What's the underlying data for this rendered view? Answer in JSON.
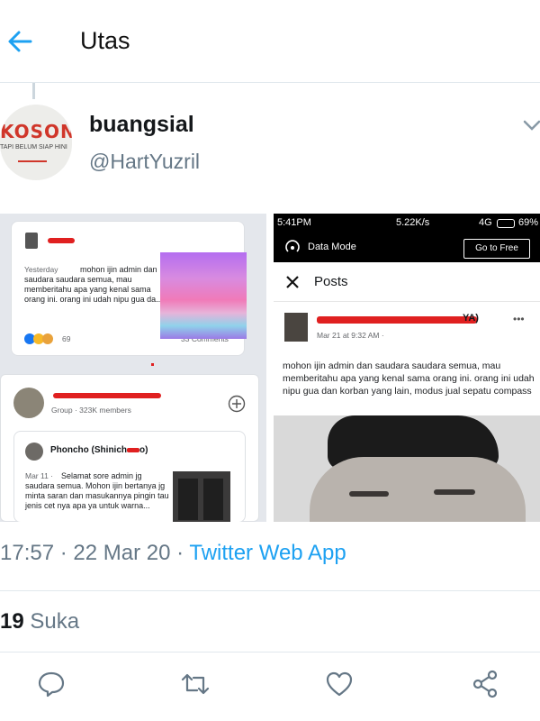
{
  "header": {
    "title": "Utas",
    "back_icon": "arrow-left-icon"
  },
  "tweet": {
    "avatar": {
      "title": "KOSONG",
      "subtitle": "TAPI BELUM SIAP HINI"
    },
    "name": "buangsial",
    "handle": "@HartYuzril",
    "time": "17:57",
    "date": "22 Mar 20",
    "separator": "·",
    "source": "Twitter Web App",
    "likes_count": "19",
    "likes_label": "Suka"
  },
  "screenshot_left": {
    "post1": {
      "time": "Yesterday",
      "text": "mohon ijin admin dan saudara saudara semua, mau memberitahu apa yang kenal sama orang ini. orang ini udah nipu gua da...",
      "reactions": "69",
      "comments": "33 Comments"
    },
    "group": {
      "members": "Group · 323K members"
    },
    "post2": {
      "author": "Phoncho (Shinich",
      "author_end": "o)",
      "time": "Mar 11 ·",
      "text": "Selamat sore admin jg saudara semua. Mohon ijin bertanya jg minta saran dan masukannya pingin tau jenis cet nya apa ya untuk warna..."
    }
  },
  "screenshot_right": {
    "status_time": "5:41PM",
    "status_right": "5.22K/s",
    "status_network": "4G",
    "battery": "69%",
    "data_mode": "Data Mode",
    "go_free": "Go to Free",
    "posts_title": "Posts",
    "post": {
      "author_end": "YA)",
      "time": "Mar 21 at 9:32 AM ·",
      "text": "mohon ijin admin dan saudara saudara semua, mau memberitahu apa yang kenal sama orang ini. orang ini udah nipu gua dan korban yang lain, modus jual sepatu compass"
    }
  },
  "actions": [
    "reply-icon",
    "retweet-icon",
    "like-icon",
    "share-icon"
  ],
  "colors": {
    "accent": "#1da1f2",
    "muted": "#657786",
    "redaction": "#e02020"
  }
}
